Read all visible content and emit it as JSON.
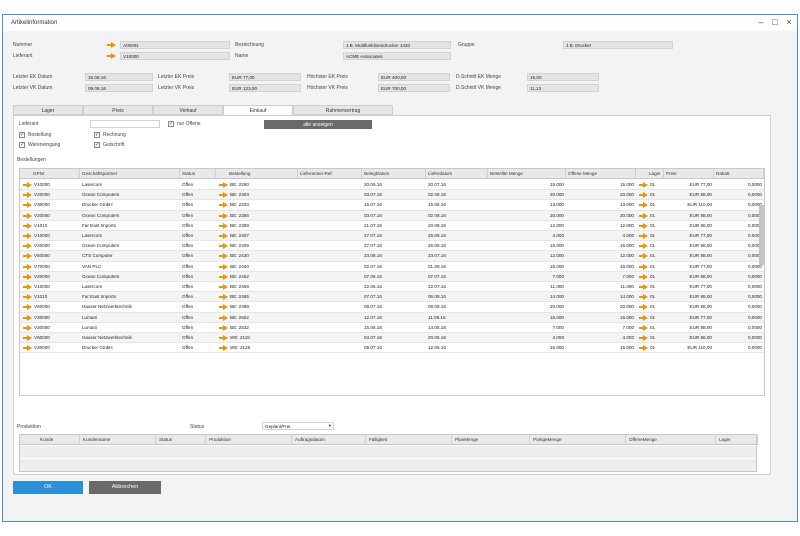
{
  "window": {
    "title": "Artikelinformation"
  },
  "header": {
    "nummer_label": "Nummer",
    "nummer_value": "A00001",
    "lieferant_label": "Lieferant",
    "lieferant_value": "V10000",
    "bezeichnung_label": "Bezeichnung",
    "bezeichnung_value": "J.B. Multifunktionsdrucker 1420",
    "name_label": "Name",
    "name_value": "ACME Associates",
    "gruppe_label": "Gruppe",
    "gruppe_value": "J.B. Drucker"
  },
  "prices": {
    "letzter_ek_datum_label": "Letzter EK Datum",
    "letzter_ek_datum": "15.08.16",
    "letzter_vk_datum_label": "Letzter VK Datum",
    "letzter_vk_datum": "09.08.16",
    "letzter_ek_preis_label": "Letzter EK Preis",
    "letzter_ek_preis": "EUR 77,00",
    "letzter_vk_preis_label": "Letzter VK Preis",
    "letzter_vk_preis": "EUR 123,00",
    "hoechster_ek_label": "Höchster EK Preis",
    "hoechster_ek": "EUR 400,00",
    "hoechster_vk_label": "Höchster VK Preis",
    "hoechster_vk": "EUR 700,00",
    "dschnitt_ek_label": "D.Schnitt EK Menge",
    "dschnitt_ek": "15,00",
    "dschnitt_vk_label": "D.Schnitt VK Menge",
    "dschnitt_vk": "11,13"
  },
  "tabs": [
    "Lager",
    "Preis",
    "Verkauf",
    "Einkauf",
    "Rahmenvertrag"
  ],
  "einkauf": {
    "lieferant_label": "Lieferant",
    "nur_offene_label": "nur Offene",
    "alle_anzeigen_label": "alle anzeigen",
    "checkboxes": [
      {
        "label": "Bestellung",
        "checked": true
      },
      {
        "label": "Rechnung",
        "checked": true
      },
      {
        "label": "Wareneingang",
        "checked": true
      },
      {
        "label": "Gutschrift",
        "checked": true
      }
    ],
    "bestellungen_label": "Bestellungen",
    "columns": [
      "GPNr",
      "Geschäftspartner",
      "Status",
      "Bestellung",
      "Lieferanten-Ref.",
      "BelegDatum",
      "Lieferdatum",
      "Bestellte Menge",
      "Offene Menge",
      "Lager",
      "Preis",
      "Rabatt"
    ],
    "rows": [
      [
        "V10000",
        "Lasercom",
        "Offen",
        "BE: 2290",
        "",
        "20.06.16",
        "20.07.16",
        "15.000",
        "15.000",
        "01",
        "EUR 77,00",
        "0,0000"
      ],
      [
        "V20000",
        "Ocean Computers",
        "Offen",
        "BE: 2303",
        "",
        "03.07.16",
        "02.08.16",
        "20.000",
        "20.000",
        "01",
        "EUR 88,00",
        "0,0000"
      ],
      [
        "V30000",
        "Drucker GmbH",
        "Offen",
        "BE: 2333",
        "",
        "16.07.16",
        "15.08.16",
        "13.000",
        "13.000",
        "01",
        "EUR 110,00",
        "0,0000"
      ],
      [
        "V20000",
        "Ocean Computers",
        "Offen",
        "BE: 2356",
        "",
        "03.07.16",
        "02.08.16",
        "20.000",
        "20.000",
        "01",
        "EUR 88,00",
        "0,0000"
      ],
      [
        "V1010",
        "Far East Imports",
        "Offen",
        "BE: 2399",
        "",
        "21.07.16",
        "20.08.16",
        "12.000",
        "12.000",
        "01",
        "EUR 88,00",
        "0,0000"
      ],
      [
        "V10000",
        "Lasercom",
        "Offen",
        "BE: 2407",
        "",
        "27.07.16",
        "26.08.16",
        "4.000",
        "4.000",
        "01",
        "EUR 77,00",
        "0,0000"
      ],
      [
        "V20000",
        "Ocean Computers",
        "Offen",
        "BE: 2409",
        "",
        "27.07.16",
        "26.08.16",
        "16.000",
        "16.000",
        "01",
        "EUR 88,00",
        "0,0000"
      ],
      [
        "V50000",
        "CTS Computer",
        "Offen",
        "BE: 2430",
        "",
        "23.06.16",
        "23.07.16",
        "12.000",
        "12.000",
        "01",
        "EUR 88,00",
        "0,0000"
      ],
      [
        "V70000",
        "VAN PLC",
        "Offen",
        "BE: 2440",
        "",
        "02.07.16",
        "01.08.16",
        "16.000",
        "16.000",
        "01",
        "EUR 77,00",
        "0,0000"
      ],
      [
        "V20000",
        "Ocean Computers",
        "Offen",
        "BE: 2452",
        "",
        "07.06.16",
        "07.07.16",
        "7.000",
        "7.000",
        "01",
        "EUR 88,00",
        "0,0000"
      ],
      [
        "V10000",
        "Lasercom",
        "Offen",
        "BE: 2459",
        "",
        "22.06.16",
        "22.07.16",
        "11.000",
        "11.000",
        "01",
        "EUR 77,00",
        "0,0000"
      ],
      [
        "V1010",
        "Far East Imports",
        "Offen",
        "BE: 2465",
        "",
        "07.07.16",
        "06.08.16",
        "14.000",
        "14.000",
        "01",
        "EUR 88,00",
        "0,0000"
      ],
      [
        "V60000",
        "Hauser Netzwerktechnik",
        "Offen",
        "BE: 2498",
        "",
        "09.07.16",
        "08.08.16",
        "20.000",
        "20.000",
        "01",
        "EUR 88,00",
        "0,0000"
      ],
      [
        "V30000",
        "Lumani",
        "Offen",
        "BE: 2502",
        "",
        "12.07.16",
        "11.08.16",
        "16.000",
        "16.000",
        "01",
        "EUR 77,00",
        "0,0000"
      ],
      [
        "V30000",
        "Lumani",
        "Offen",
        "BE: 2532",
        "",
        "15.06.16",
        "14.05.16",
        "7.000",
        "7.000",
        "01",
        "EUR 88,00",
        "0,0000"
      ],
      [
        "V60000",
        "Hauser Netzwerktechnik",
        "Offen",
        "WE: 2118",
        "",
        "04.07.16",
        "20.05.16",
        "4.000",
        "4.000",
        "01",
        "EUR 88,00",
        "0,0000"
      ],
      [
        "V30000",
        "Drucker GmbH",
        "Offen",
        "WE: 2126",
        "",
        "09.07.16",
        "12.05.16",
        "15.000",
        "15.000",
        "01",
        "EUR 110,00",
        "0,0000"
      ]
    ],
    "produktion_label": "Produktion",
    "status_label": "Status",
    "status_value": "Geplant/Frei.",
    "prod_columns": [
      "Kunde",
      "Kundenname",
      "Status",
      "Produktion",
      "Auftragsdatum",
      "Fälligkeit",
      "PlanMenge",
      "PortigeMenge",
      "OffeneMenge",
      "Lager"
    ]
  },
  "footer": {
    "ok_label": "OK",
    "abbrechen_label": "Abbrechen"
  },
  "colors": {
    "accent": "#2d8fd6",
    "arrow": "#e8960c",
    "frame": "#4a90d9"
  }
}
